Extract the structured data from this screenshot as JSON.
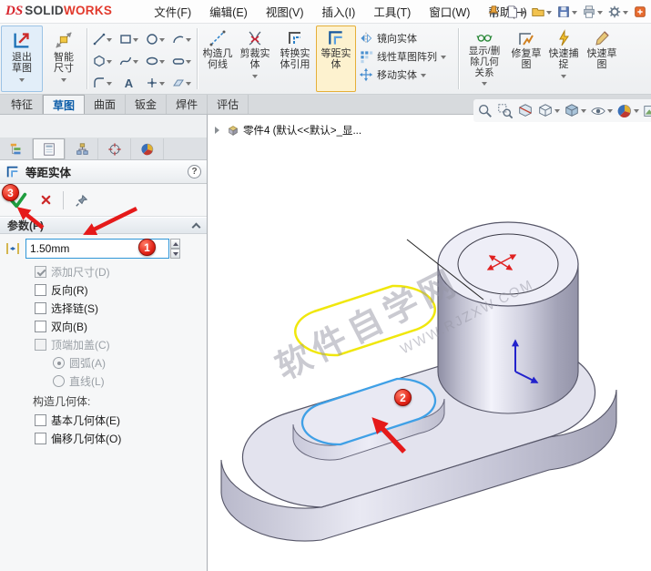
{
  "menubar": {
    "logo_ds": "DS",
    "logo_solid": "SOLID",
    "logo_works": "WORKS",
    "items": [
      {
        "label": "文件(F)"
      },
      {
        "label": "编辑(E)"
      },
      {
        "label": "视图(V)"
      },
      {
        "label": "插入(I)"
      },
      {
        "label": "工具(T)"
      },
      {
        "label": "窗口(W)"
      },
      {
        "label": "帮助(H)"
      }
    ],
    "toolbar_icons": [
      "menu-pin",
      "new-document",
      "open",
      "save",
      "print",
      "settings",
      "resources"
    ]
  },
  "ribbon": {
    "exit_sketch": {
      "line1": "退出",
      "line2": "草图"
    },
    "smart_dimension": {
      "line1": "智能",
      "line2": "尺寸"
    },
    "sketch_tools": [
      "line",
      "rectangle",
      "circle",
      "arc",
      "polygon",
      "spline",
      "ellipse",
      "slot",
      "fillet",
      "text",
      "point",
      "plane"
    ],
    "text_tool_glyph": "A",
    "construction_geometry": {
      "line1": "构造几",
      "line2": "何线"
    },
    "trim_entities": {
      "line1": "剪裁实",
      "line2": "体"
    },
    "convert_entities": {
      "line1": "转换实",
      "line2": "体引用"
    },
    "offset_entities": {
      "line1": "等距实",
      "line2": "体"
    },
    "mirror_entities": {
      "label": "镜向实体"
    },
    "linear_pattern": {
      "label": "线性草图阵列"
    },
    "move_entities": {
      "label": "移动实体"
    },
    "display_relations": {
      "line1": "显示/删",
      "line2": "除几何",
      "line3": "关系"
    },
    "repair_sketch": {
      "line1": "修复草",
      "line2": "图"
    },
    "quick_snaps": {
      "line1": "快速捕",
      "line2": "捉"
    },
    "rapid_sketch": {
      "line1": "快速草",
      "line2": "图"
    }
  },
  "tabs": [
    {
      "label": "特征",
      "active": false
    },
    {
      "label": "草图",
      "active": true
    },
    {
      "label": "曲面",
      "active": false
    },
    {
      "label": "钣金",
      "active": false
    },
    {
      "label": "焊件",
      "active": false
    },
    {
      "label": "评估",
      "active": false
    }
  ],
  "headsup_icons": [
    "zoom-fit",
    "zoom-area",
    "section-view",
    "view-orientation",
    "display-style",
    "hide-show-items",
    "appearances",
    "scene"
  ],
  "panel": {
    "title": "等距实体",
    "help_glyph": "?",
    "tab_icons": [
      "feature-manager",
      "property-manager",
      "configuration-manager",
      "dimxpert-manager",
      "display-manager"
    ],
    "sections": {
      "parameters": "参数(P)"
    },
    "distance_value": "1.50mm",
    "options": [
      {
        "id": "add_dimensions",
        "label": "添加尺寸(D)",
        "type": "checkbox",
        "checked": true,
        "enabled": false
      },
      {
        "id": "reverse",
        "label": "反向(R)",
        "type": "checkbox",
        "checked": false,
        "enabled": true
      },
      {
        "id": "select_chain",
        "label": "选择链(S)",
        "type": "checkbox",
        "checked": false,
        "enabled": true
      },
      {
        "id": "bidirectional",
        "label": "双向(B)",
        "type": "checkbox",
        "checked": false,
        "enabled": true
      },
      {
        "id": "cap_ends",
        "label": "顶端加盖(C)",
        "type": "checkbox",
        "checked": false,
        "enabled": false
      },
      {
        "id": "arcs",
        "label": "圆弧(A)",
        "type": "radio",
        "checked": true,
        "enabled": false
      },
      {
        "id": "lines",
        "label": "直线(L)",
        "type": "radio",
        "checked": false,
        "enabled": false
      },
      {
        "id": "construction",
        "label": "构造几何体:",
        "type": "label"
      },
      {
        "id": "base_geometry",
        "label": "基本几何体(E)",
        "type": "checkbox",
        "checked": false,
        "enabled": true
      },
      {
        "id": "offset_geometry",
        "label": "偏移几何体(O)",
        "type": "checkbox",
        "checked": false,
        "enabled": true
      }
    ]
  },
  "viewport": {
    "tree_item": "零件4 (默认<<默认>_显...",
    "watermark_cn": "软件自学网",
    "watermark_url": "WWW.RJZXW.COM"
  },
  "annotations": {
    "badge1": "1",
    "badge2": "2",
    "badge3": "3"
  },
  "colors": {
    "accent_orange": "#e5af38",
    "selection_blue": "#3fa0e6",
    "sketch_yellow": "#f0e70c",
    "annotation_red": "#e22418",
    "check_green": "#1f9d3f"
  }
}
